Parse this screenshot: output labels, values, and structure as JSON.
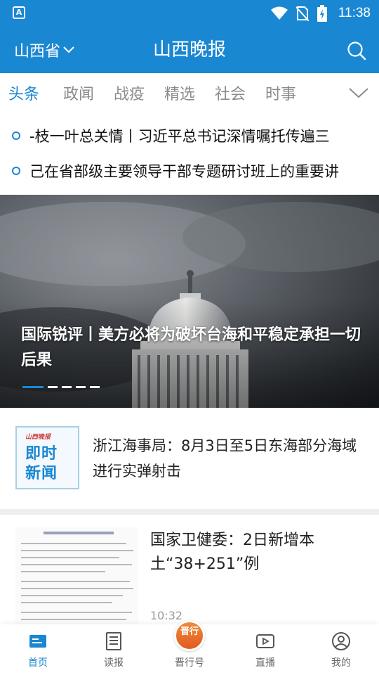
{
  "status_bar": {
    "time": "11:38",
    "left_icon_letter": "A",
    "icons": [
      "wifi-icon",
      "sim-off-icon",
      "battery-charging-icon"
    ]
  },
  "header": {
    "region": "山西省",
    "title": "山西晚报",
    "icons": [
      "chevron-down-icon",
      "search-icon"
    ]
  },
  "tabs": [
    {
      "label": "头条",
      "active": true
    },
    {
      "label": "政闻"
    },
    {
      "label": "战疫"
    },
    {
      "label": "精选"
    },
    {
      "label": "社会"
    },
    {
      "label": "时事"
    }
  ],
  "ticker": [
    {
      "text": "-枝一叶总关情丨习近平总书记深情嘱托传遍三"
    },
    {
      "text": "己在省部级主要领导干部专题研讨班上的重要讲"
    }
  ],
  "hero": {
    "caption": "国际锐评丨美方必将为破坏台海和平稳定承担一切后果",
    "slide_count": 5,
    "active_slide": 1
  },
  "news": [
    {
      "thumb_brand": "山西晚报",
      "thumb_text": "即时新闻",
      "title": "浙江海事局：8月3日至5日东海部分海域进行实弹射击"
    },
    {
      "title": "国家卫健委：2日新增本土“38+251”例",
      "time": "10:32"
    }
  ],
  "bottom_nav": [
    {
      "label": "首页",
      "icon": "home-news-icon",
      "active": true
    },
    {
      "label": "读报",
      "icon": "newspaper-icon"
    },
    {
      "label": "晋行号",
      "icon": "jinxing-badge-icon",
      "badge_text": "晋行"
    },
    {
      "label": "直播",
      "icon": "live-play-icon"
    },
    {
      "label": "我的",
      "icon": "profile-icon"
    }
  ],
  "colors": {
    "brand": "#1a87d3",
    "tab_inactive": "#8c8c8c",
    "badge_orange": "#e25a1f"
  }
}
